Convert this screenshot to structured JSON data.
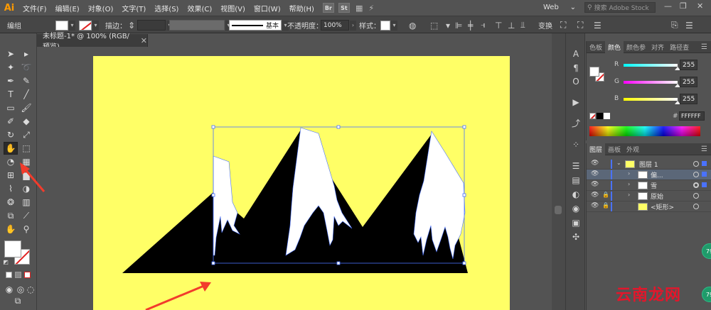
{
  "app": {
    "logo": "Ai"
  },
  "menu": [
    "文件(F)",
    "编辑(E)",
    "对象(O)",
    "文字(T)",
    "选择(S)",
    "效果(C)",
    "视图(V)",
    "窗口(W)",
    "帮助(H)"
  ],
  "menu_badges": [
    "Br",
    "St"
  ],
  "workspace": "Web",
  "stock_search": {
    "placeholder": "搜索 Adobe Stock"
  },
  "control": {
    "selection_label": "编组",
    "stroke_label": "描边：",
    "stroke_style": "基本",
    "opacity_label": "不透明度：",
    "opacity_value": "100%",
    "style_label": "样式：",
    "transform_label": "变换"
  },
  "document": {
    "tab_title": "未标题-1* @ 100% (RGB/预览)"
  },
  "color_panel": {
    "tabs": [
      "色板",
      "颜色",
      "颜色参",
      "对齐",
      "路径查"
    ],
    "active_tab": "颜色",
    "r_label": "R",
    "r_value": "255",
    "g_label": "G",
    "g_value": "255",
    "b_label": "B",
    "b_value": "255",
    "hex_symbol": "#",
    "hex_value": "FFFFFF"
  },
  "layers_panel": {
    "tabs": [
      "图层",
      "画板",
      "外观"
    ],
    "rows": [
      {
        "name": "图层 1"
      },
      {
        "name": "偏..."
      },
      {
        "name": "雪"
      },
      {
        "name": "原始"
      },
      {
        "name": "<矩形>"
      }
    ]
  },
  "watermark": "云南龙网",
  "bubble_label": "79",
  "colors": {
    "artboard": "#ffff66",
    "mountain": "#000000",
    "snow": "#ffffff",
    "selection": "#4a72ff",
    "arrow": "#f23c2c"
  }
}
